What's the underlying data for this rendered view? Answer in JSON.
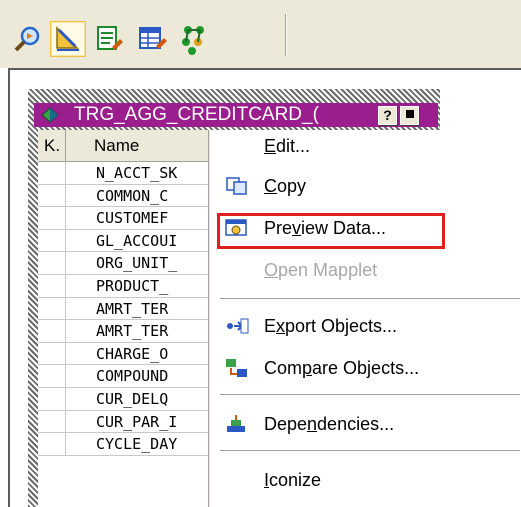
{
  "toolbar": {
    "buttons": [
      {
        "icon": "find-icon"
      },
      {
        "icon": "arrange-icon",
        "active": true
      },
      {
        "icon": "edit-object-icon"
      },
      {
        "icon": "table-icon"
      },
      {
        "icon": "tree-icon"
      }
    ]
  },
  "transformation": {
    "title": "TRG_AGG_CREDITCARD_( ",
    "help_label": "?",
    "minimize_label": "▬",
    "columns": {
      "key": "K.",
      "name": "Name"
    },
    "rows": [
      "N_ACCT_SK",
      "COMMON_C",
      "CUSTOMEF",
      "GL_ACCOUI",
      "ORG_UNIT_",
      "PRODUCT_",
      "AMRT_TER",
      "AMRT_TER",
      "CHARGE_O",
      "COMPOUND",
      "CUR_DELQ",
      "CUR_PAR_I",
      "CYCLE_DAY"
    ]
  },
  "context_menu": {
    "items": [
      {
        "pre": "",
        "accel": "E",
        "post": "dit...",
        "disabled": false,
        "icon": ""
      },
      {
        "pre": "",
        "accel": "C",
        "post": "opy",
        "disabled": false,
        "icon": "copy-icon"
      },
      {
        "pre": "Pre",
        "accel": "v",
        "post": "iew Data...",
        "disabled": false,
        "icon": "preview-data-icon"
      },
      {
        "pre": "",
        "accel": "O",
        "post": "pen Mapplet",
        "disabled": true,
        "icon": ""
      },
      {
        "pre": "E",
        "accel": "x",
        "post": "port Objects...",
        "disabled": false,
        "icon": "export-icon"
      },
      {
        "pre": "Com",
        "accel": "p",
        "post": "are Objects...",
        "disabled": false,
        "icon": "compare-icon"
      },
      {
        "pre": "Depe",
        "accel": "n",
        "post": "dencies...",
        "disabled": false,
        "icon": "dependencies-icon"
      },
      {
        "pre": "",
        "accel": "I",
        "post": "conize",
        "disabled": false,
        "icon": ""
      }
    ]
  },
  "colors": {
    "titlebar": "#9b1e8e",
    "highlight": "#e02020",
    "disabled_text": "#a8a8a8",
    "toolbar_bg": "#ece9d8"
  }
}
